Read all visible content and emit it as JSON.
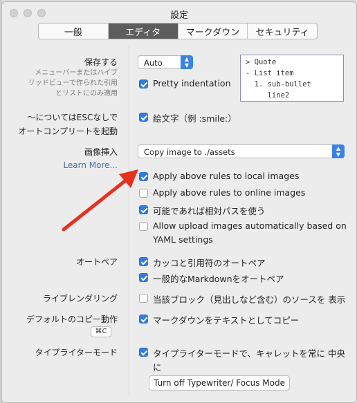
{
  "window": {
    "title": "設定"
  },
  "tabs": [
    "一般",
    "エディタ",
    "マークダウン",
    "セキュリティ"
  ],
  "active_tab": 1,
  "save": {
    "label": "保存する",
    "note_line1": "メニューバーまたはハイブ",
    "note_line2": "リッドビューで作られた引用",
    "note_line3": "とリストにのみ適用",
    "select_value": "Auto",
    "pretty_label": "Pretty indentation",
    "pretty_checked": true
  },
  "preview": {
    "line1": "> Quote",
    "line2": "- List item",
    "line3": "  1. sub-bullet",
    "line4": "     line2"
  },
  "esc": {
    "label_line1": "～についてはESCなしで",
    "label_line2": "オートコンプリートを起動",
    "emoji_label": "絵文字（例 :smile:）",
    "emoji_checked": true
  },
  "image": {
    "label": "画像挿入",
    "learn_more": "Learn More...",
    "select_value": "Copy image to ./assets",
    "options": [
      {
        "label": "Apply above rules to local images",
        "checked": true
      },
      {
        "label": "Apply above rules to online images",
        "checked": false
      },
      {
        "label": "可能であれば相対パスを使う",
        "checked": true
      },
      {
        "label": "Allow upload images automatically based on",
        "label2": "YAML settings",
        "checked": false
      }
    ]
  },
  "autopair": {
    "label": "オートペア",
    "options": [
      {
        "label": "カッコと引用符のオートペア",
        "checked": true
      },
      {
        "label": "一般的なMarkdownをオートペア",
        "checked": true
      }
    ]
  },
  "live": {
    "label": "ライブレンダリング",
    "option_label": "当該ブロック（見出しなど含む）のソースを 表示",
    "checked": false
  },
  "copy": {
    "label": "デフォルトのコピー動作",
    "shortcut": "⌘C",
    "option_label": "マークダウンをテキストとしてコピー",
    "checked": true
  },
  "typewriter": {
    "label": "タイプライターモード",
    "option_line1": "タイプライターモードで、キャレットを常に 中央",
    "option_line2": "に",
    "checked": true,
    "button_label": "Turn off Typewriter/ Focus Mode"
  },
  "colors": {
    "accent": "#2f7de1",
    "arrow": "#e8301f",
    "active_tab": "#5d5d5d"
  }
}
